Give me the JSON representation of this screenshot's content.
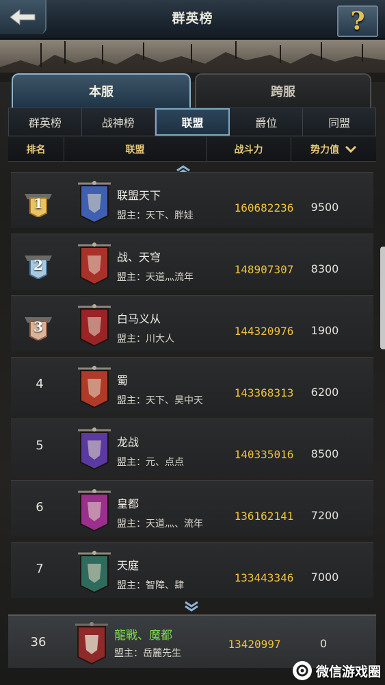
{
  "header": {
    "title": "群英榜",
    "help_glyph": "?"
  },
  "main_tabs": [
    {
      "label": "本服",
      "active": true
    },
    {
      "label": "跨服",
      "active": false
    }
  ],
  "sub_tabs": [
    {
      "label": "群英榜",
      "active": false
    },
    {
      "label": "战神榜",
      "active": false
    },
    {
      "label": "联盟",
      "active": true
    },
    {
      "label": "爵位",
      "active": false
    },
    {
      "label": "同盟",
      "active": false
    }
  ],
  "columns": {
    "rank": "排名",
    "alliance": "联盟",
    "power": "战斗力",
    "influence": "势力值"
  },
  "rows": [
    {
      "rank": "1",
      "name": "联盟天下",
      "leader": "盟主：天下、胖娃",
      "power": "160682236",
      "influence": "9500",
      "medal": "gold",
      "banner_color": "#3f5fb0"
    },
    {
      "rank": "2",
      "name": "战、天穹",
      "leader": "盟主：天道灬流年",
      "power": "148907307",
      "influence": "8300",
      "medal": "silver",
      "banner_color": "#a8322a"
    },
    {
      "rank": "3",
      "name": "白马义从",
      "leader": "盟主：川大人",
      "power": "144320976",
      "influence": "1900",
      "medal": "bronze",
      "banner_color": "#9a2326"
    },
    {
      "rank": "4",
      "name": "蜀",
      "leader": "盟主：天下、昊中天",
      "power": "143368313",
      "influence": "6200",
      "medal": "",
      "banner_color": "#b03a28"
    },
    {
      "rank": "5",
      "name": "龙战",
      "leader": "盟主：元、点点",
      "power": "140335016",
      "influence": "8500",
      "medal": "",
      "banner_color": "#5a3aa0"
    },
    {
      "rank": "6",
      "name": "皇都",
      "leader": "盟主：天道灬、流年",
      "power": "136162141",
      "influence": "7200",
      "medal": "",
      "banner_color": "#9a2f8e"
    },
    {
      "rank": "7",
      "name": "天庭",
      "leader": "盟主：智障、肆",
      "power": "133443346",
      "influence": "7000",
      "medal": "",
      "banner_color": "#2f6b5c"
    }
  ],
  "my_alliance": {
    "rank": "36",
    "name": "龍戰、魔都",
    "leader": "盟主：岳麓先生",
    "power": "13420997",
    "influence": "0",
    "banner_color": "#8e2a2a"
  },
  "watermark": {
    "text": "微信游戏圈"
  },
  "colors": {
    "power_text": "#f0c23d",
    "my_alliance_name": "#7cd94c",
    "header_text": "#e7c97a"
  }
}
